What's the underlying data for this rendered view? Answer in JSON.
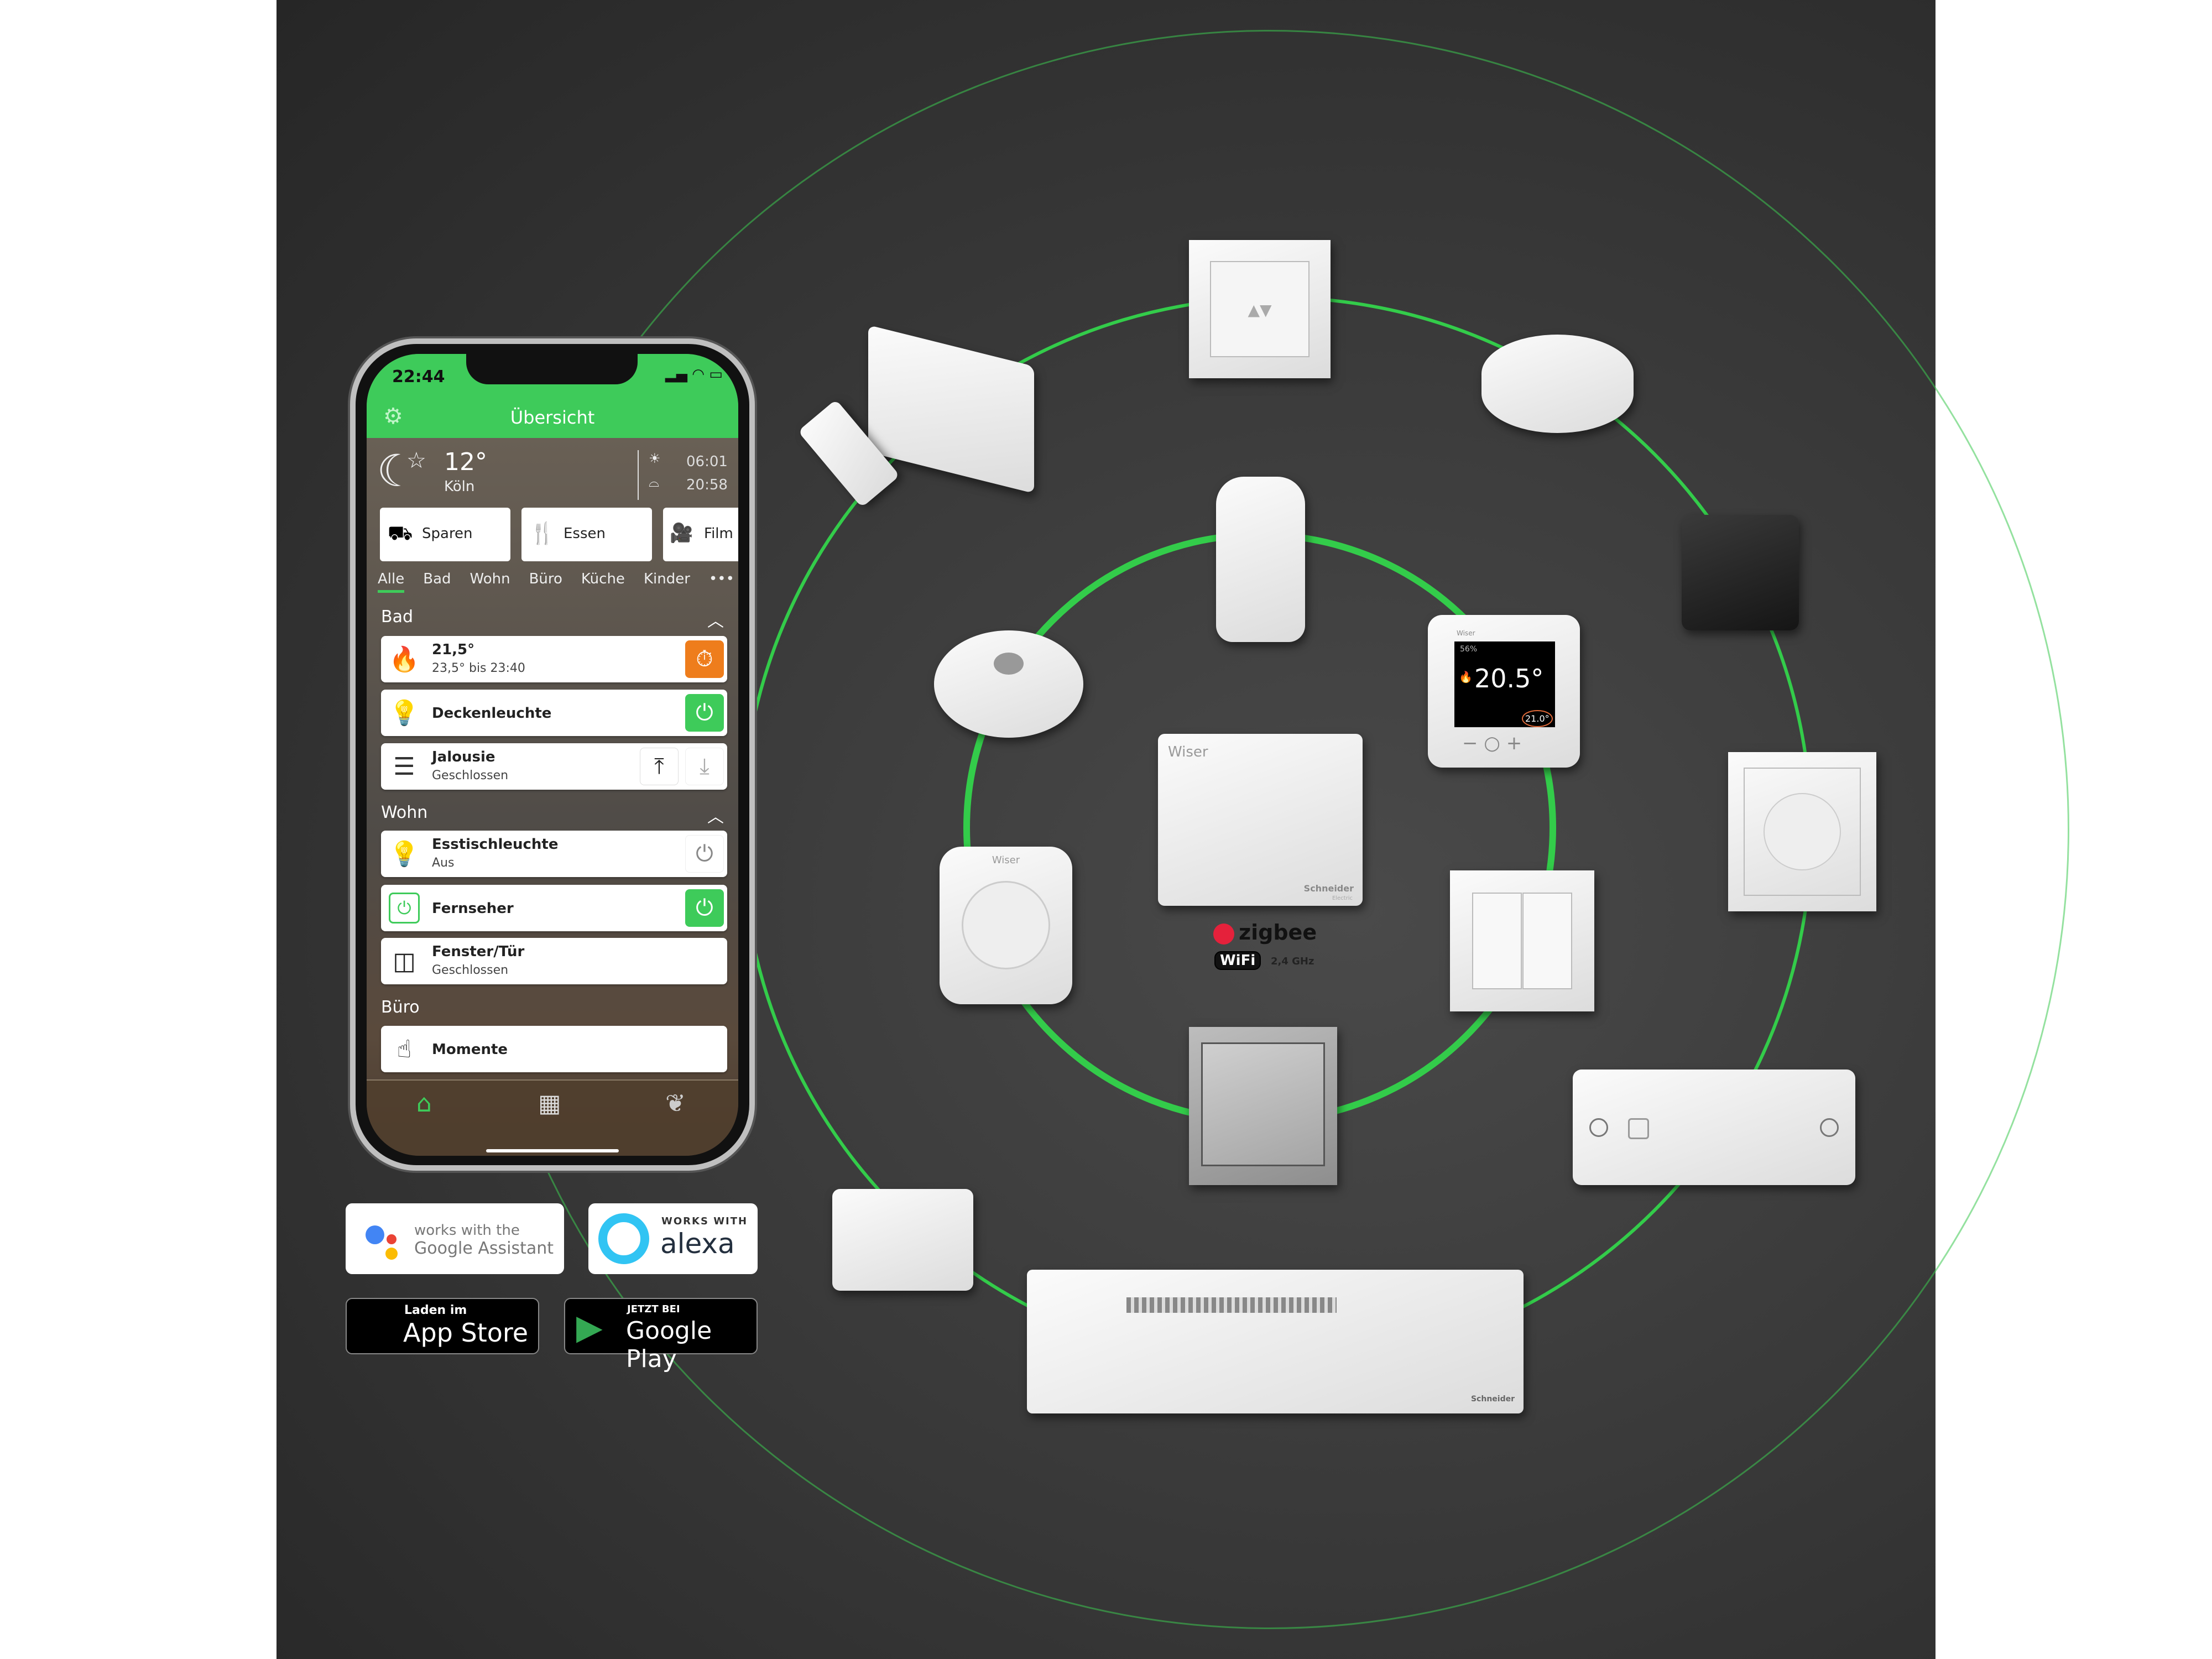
{
  "phone": {
    "time": "22:44",
    "header_title": "Übersicht",
    "weather": {
      "temp": "12°",
      "city": "Köln",
      "sunrise": "06:01",
      "sunset": "20:58"
    },
    "scenes": [
      {
        "label": "Sparen"
      },
      {
        "label": "Essen"
      },
      {
        "label": "Film"
      }
    ],
    "tabs": [
      {
        "label": "Alle",
        "active": true
      },
      {
        "label": "Bad"
      },
      {
        "label": "Wohn"
      },
      {
        "label": "Büro"
      },
      {
        "label": "Küche"
      },
      {
        "label": "Kinder"
      }
    ],
    "more": "•••",
    "sections": {
      "bad": {
        "title": "Bad",
        "items": [
          {
            "title": "21,5°",
            "sub": "23,5° bis 23:40"
          },
          {
            "title": "Deckenleuchte"
          },
          {
            "title": "Jalousie",
            "sub": "Geschlossen"
          }
        ]
      },
      "wohn": {
        "title": "Wohn",
        "items": [
          {
            "title": "Esstischleuchte",
            "sub": "Aus"
          },
          {
            "title": "Fernseher"
          },
          {
            "title": "Fenster/Tür",
            "sub": "Geschlossen"
          }
        ]
      },
      "buero": {
        "title": "Büro",
        "items": [
          {
            "title": "Momente"
          }
        ]
      }
    }
  },
  "badges": {
    "google_assistant": {
      "line1": "works with the",
      "line2": "Google Assistant"
    },
    "alexa": {
      "line1": "WORKS WITH",
      "line2": "alexa"
    },
    "app_store": {
      "line1": "Laden im",
      "line2": "App Store"
    },
    "google_play": {
      "line1": "JETZT BEI",
      "line2": "Google Play"
    }
  },
  "devices": {
    "hub_label": "Wiser",
    "hub_brand": "Schneider",
    "hub_brand_sub": "Electric",
    "plug_label": "Wiser",
    "thermostat": {
      "label": "Wiser",
      "humidity": "56%",
      "temp": "20.5°",
      "setpoint": "21.0°"
    },
    "protocols": {
      "zigbee": "zigbee",
      "wifi": "WiFi",
      "wifi_band": "2,4 GHz"
    },
    "controller_brand": "Schneider"
  },
  "colors": {
    "accent": "#3ecb5a",
    "heating": "#ee7d1c",
    "ring": "#33cc4a"
  }
}
